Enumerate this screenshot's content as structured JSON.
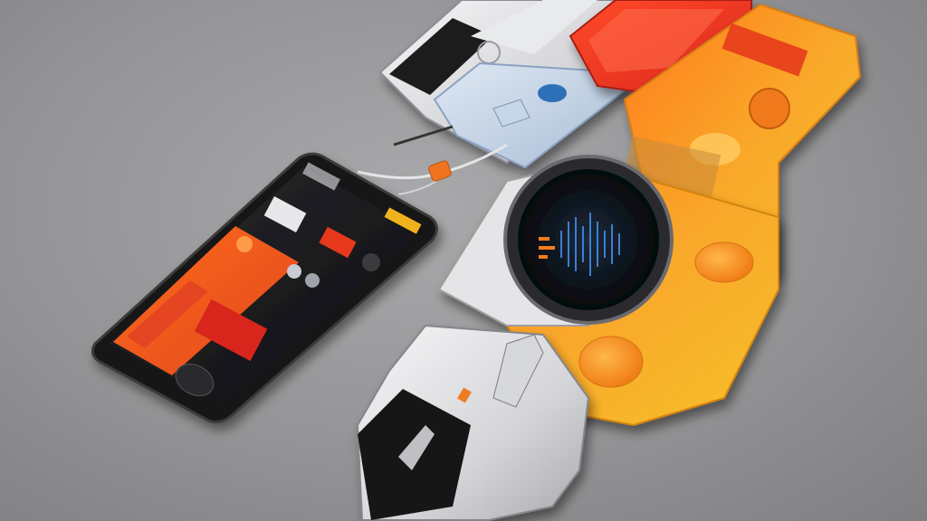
{
  "scene": {
    "description_free": true,
    "palette": {
      "background": "#9a9a9c",
      "orange": "#f26a1b",
      "orange_light": "#ff9a2e",
      "yellow": "#f6b71f",
      "red": "#e6331f",
      "black": "#121214",
      "silver": "#d8d9dc",
      "screen_blue": "#2e6fb8"
    },
    "objects": [
      {
        "name": "smartphone-left",
        "icon": "phone-icon"
      },
      {
        "name": "silver-device-top",
        "icon": "device-icon"
      },
      {
        "name": "red-card-top",
        "icon": "card-icon"
      },
      {
        "name": "orange-panel-right",
        "icon": "panel-icon"
      },
      {
        "name": "round-display-device",
        "icon": "gauge-icon"
      },
      {
        "name": "cable-with-plug",
        "icon": "plug-icon"
      }
    ]
  }
}
